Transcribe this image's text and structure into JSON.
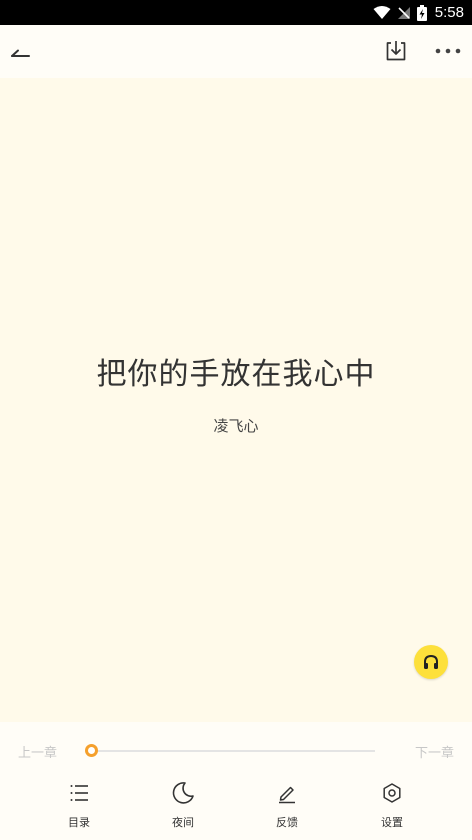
{
  "status_bar": {
    "time": "5:58"
  },
  "top_bar": {},
  "book": {
    "title": "把你的手放在我心中",
    "author": "凌飞心"
  },
  "progress": {
    "prev_label": "上一章",
    "next_label": "下一章",
    "value": 0
  },
  "tabs": [
    {
      "label": "目录",
      "icon": "list-icon"
    },
    {
      "label": "夜间",
      "icon": "moon-icon"
    },
    {
      "label": "反馈",
      "icon": "edit-icon"
    },
    {
      "label": "设置",
      "icon": "settings-icon"
    }
  ],
  "colors": {
    "background": "#fffaea",
    "accent": "#f5a02c",
    "fab": "#fde03b"
  }
}
